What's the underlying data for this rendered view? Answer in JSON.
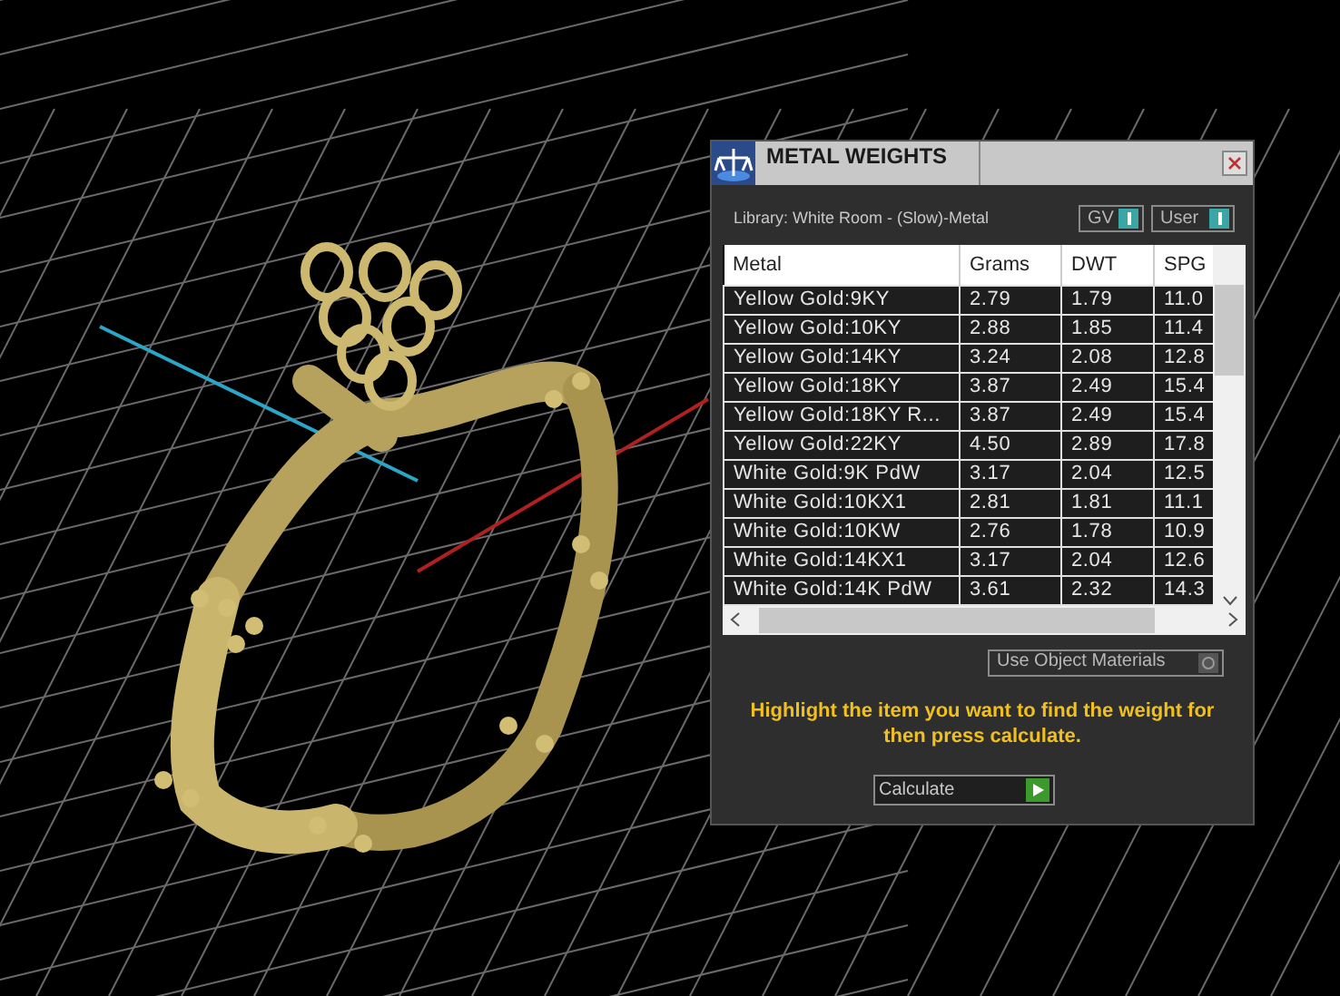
{
  "panel": {
    "title": "METAL WEIGHTS",
    "library": "Library: White Room - (Slow)-Metal",
    "toggles": [
      {
        "label": "GV",
        "on": true
      },
      {
        "label": "User",
        "on": true
      }
    ],
    "table": {
      "columns": [
        "Metal",
        "Grams",
        "DWT",
        "SPG"
      ],
      "rows": [
        [
          "Yellow Gold:9KY",
          "2.79",
          "1.79",
          "11.0"
        ],
        [
          "Yellow Gold:10KY",
          "2.88",
          "1.85",
          "11.4"
        ],
        [
          "Yellow Gold:14KY",
          "3.24",
          "2.08",
          "12.8"
        ],
        [
          "Yellow Gold:18KY",
          "3.87",
          "2.49",
          "15.4"
        ],
        [
          "Yellow Gold:18KY R...",
          "3.87",
          "2.49",
          "15.4"
        ],
        [
          "Yellow Gold:22KY",
          "4.50",
          "2.89",
          "17.8"
        ],
        [
          "White Gold:9K PdW",
          "3.17",
          "2.04",
          "12.5"
        ],
        [
          "White Gold:10KX1",
          "2.81",
          "1.81",
          "11.1"
        ],
        [
          "White Gold:10KW",
          "2.76",
          "1.78",
          "10.9"
        ],
        [
          "White Gold:14KX1",
          "3.17",
          "2.04",
          "12.6"
        ],
        [
          "White Gold:14K PdW",
          "3.61",
          "2.32",
          "14.3"
        ]
      ]
    },
    "use_object_materials": {
      "label": "Use Object Materials",
      "on": false
    },
    "hint": "Highlight the item you want to find the weight for then press calculate.",
    "calculate": "Calculate"
  }
}
